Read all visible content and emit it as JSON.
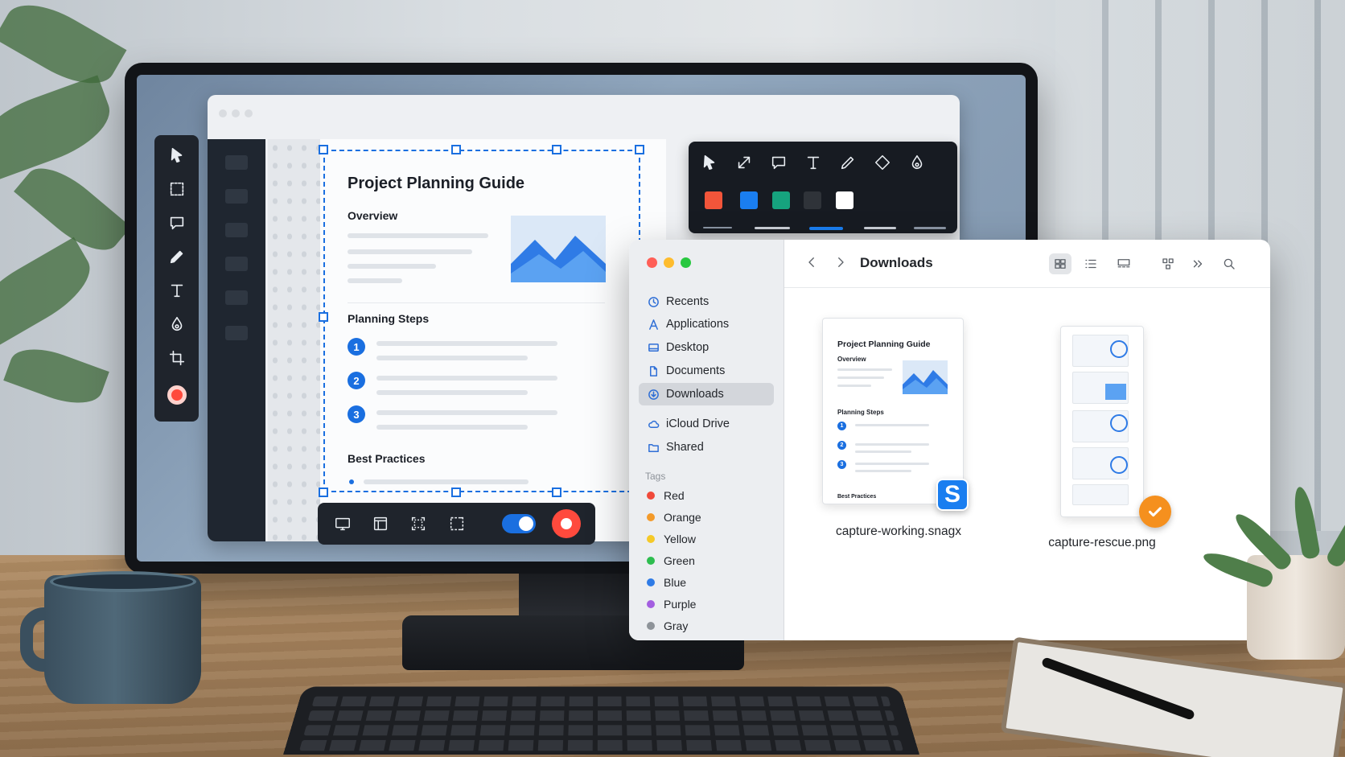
{
  "document": {
    "title": "Project Planning Guide",
    "overview_heading": "Overview",
    "steps_heading": "Planning Steps",
    "steps": [
      "1",
      "2",
      "3"
    ],
    "practices_heading": "Best Practices"
  },
  "annotation_toolbar": {
    "tools": [
      "arrow-pointer-icon",
      "line-arrow-icon",
      "speech-bubble-icon",
      "text-icon",
      "pen-icon",
      "eraser-icon",
      "fill-icon"
    ],
    "colors": [
      "#f2553a",
      "#1a7ef0",
      "#16a37e",
      "#2f3339",
      "#ffffff"
    ]
  },
  "tool_rail": {
    "tools": [
      "select-icon",
      "region-icon",
      "callout-icon",
      "pen-icon",
      "text-icon",
      "blur-icon",
      "crop-icon",
      "record-icon"
    ]
  },
  "capture_bar": {
    "modes": [
      "fullscreen-icon",
      "window-icon",
      "region-icon",
      "scrolling-icon"
    ],
    "toggle_on": true
  },
  "finder": {
    "title": "Downloads",
    "sidebar": [
      {
        "label": "Recents",
        "icon": "clock-icon"
      },
      {
        "label": "Applications",
        "icon": "apps-icon"
      },
      {
        "label": "Desktop",
        "icon": "desktop-icon"
      },
      {
        "label": "Documents",
        "icon": "document-icon"
      },
      {
        "label": "Downloads",
        "icon": "download-icon",
        "active": true
      },
      {
        "label": "iCloud Drive",
        "icon": "cloud-icon"
      },
      {
        "label": "Shared",
        "icon": "shared-folder-icon"
      }
    ],
    "tags_heading": "Tags",
    "tags": [
      {
        "label": "Red",
        "color": "#f0493a"
      },
      {
        "label": "Orange",
        "color": "#f39a2a"
      },
      {
        "label": "Yellow",
        "color": "#f5c928"
      },
      {
        "label": "Green",
        "color": "#2ebd4f"
      },
      {
        "label": "Blue",
        "color": "#2f7be6"
      },
      {
        "label": "Purple",
        "color": "#a35ee0"
      },
      {
        "label": "Gray",
        "color": "#8e9399"
      }
    ],
    "files": [
      {
        "name": "capture-working.snagx",
        "preview_title": "Project Planning Guide",
        "preview_overview": "Overview",
        "preview_steps": "Planning Steps",
        "preview_footer": "Best Practices",
        "badge": "S"
      },
      {
        "name": "capture-rescue.png"
      }
    ]
  },
  "colors": {
    "accent": "#1a6fe0",
    "record": "#ff4a3d",
    "badge_orange": "#f5901e"
  }
}
